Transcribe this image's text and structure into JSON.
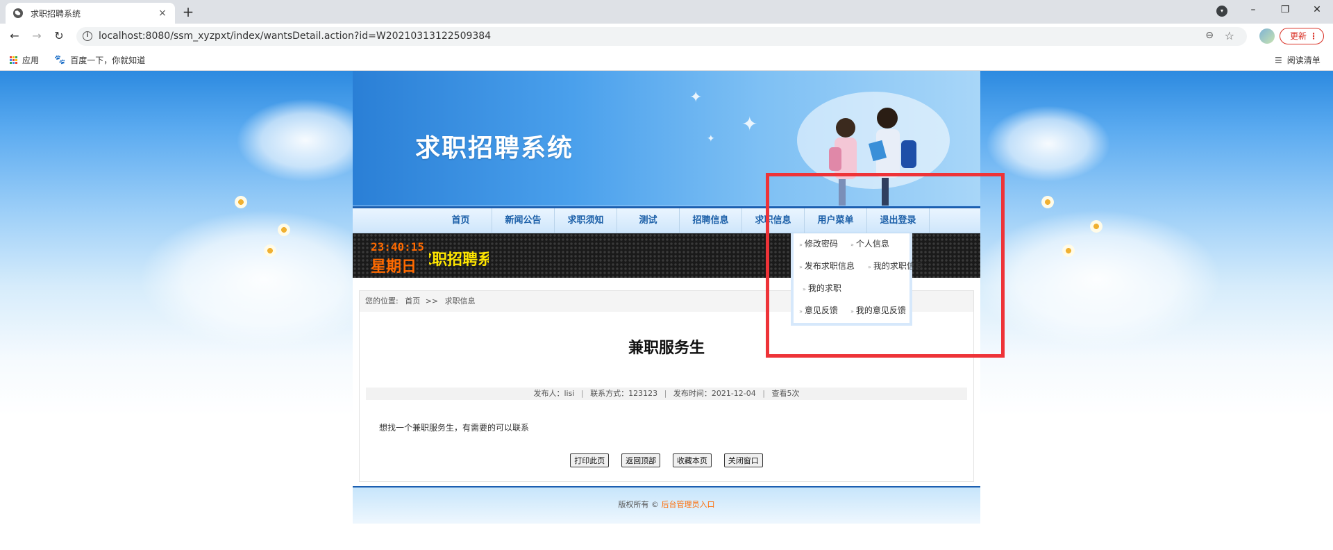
{
  "browser": {
    "tab_title": "求职招聘系统",
    "tab_close": "×",
    "new_tab": "+",
    "url": "localhost:8080/ssm_xyzpxt/index/wantsDetail.action?id=W20210313122509384",
    "update_label": "更新",
    "update_menu": "⋮",
    "bookmarks": [
      {
        "label": "应用"
      },
      {
        "label": "百度一下，你就知道"
      }
    ],
    "reading_list": "阅读清单",
    "window_controls": [
      "–",
      "❐",
      "✕"
    ],
    "nav_buttons": [
      "←",
      "→",
      "↻"
    ]
  },
  "site": {
    "banner_title": "求职招聘系统",
    "nav": [
      {
        "label": "首页"
      },
      {
        "label": "新闻公告"
      },
      {
        "label": "求职须知"
      },
      {
        "label": "测试"
      },
      {
        "label": "招聘信息"
      },
      {
        "label": "求职信息"
      },
      {
        "label": "用户菜单"
      },
      {
        "label": "退出登录"
      }
    ],
    "ticker": {
      "time": "23:40:15",
      "weekday": "星期日",
      "scroll_text": "求职招聘系统"
    },
    "user_menu": [
      {
        "label": "修改密码"
      },
      {
        "label": "个人信息"
      },
      {
        "label": "发布求职信息"
      },
      {
        "label": "我的求职信息"
      },
      {
        "label": "我的求职"
      },
      {
        "label": "意见反馈"
      },
      {
        "label": "我的意见反馈"
      }
    ],
    "breadcrumb": {
      "prefix": "您的位置:",
      "home": "首页",
      "sep": ">>",
      "current": "求职信息"
    },
    "post": {
      "title": "兼职服务生",
      "publisher": "发布人：lisi",
      "contact": "联系方式：123123",
      "published": "发布时间：2021-12-04",
      "views": "查看5次",
      "meta_sep": "|",
      "content": "想找一个兼职服务生，有需要的可以联系"
    },
    "actions": {
      "print": "打印此页",
      "top": "返回顶部",
      "favorite": "收藏本页",
      "close": "关闭窗口"
    },
    "footer": {
      "copyright": "版权所有 ©",
      "admin_link": "后台管理员入口"
    }
  },
  "colors": {
    "highlight_border": "#ee3338",
    "nav_text": "#1b5fa8",
    "ticker_clock": "#ff6a00",
    "ticker_text": "#ffe600",
    "footer_link": "#ff6a00"
  }
}
